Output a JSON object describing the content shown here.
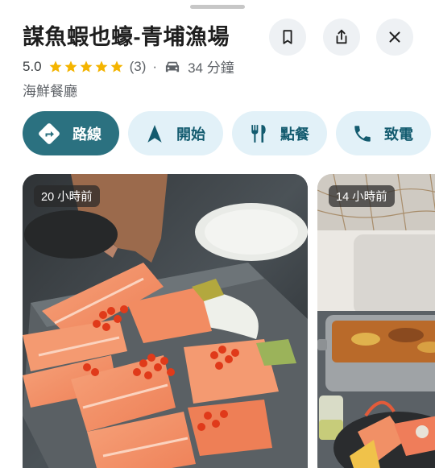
{
  "place": {
    "name": "謀魚蝦也蠔-青埔漁場",
    "rating": "5.0",
    "review_count": "(3)",
    "separator": "·",
    "drive_time": "34 分鐘",
    "category": "海鮮餐廳",
    "stars_filled": 5
  },
  "actions": {
    "directions": "路線",
    "start": "開始",
    "order": "點餐",
    "call": "致電"
  },
  "photos": [
    {
      "time_badge": "20 小時前"
    },
    {
      "time_badge": "14 小時前"
    }
  ],
  "colors": {
    "primary_chip": "#2b7180",
    "chip_bg": "#e2f1f8",
    "chip_text": "#135b6f",
    "star": "#f4b400"
  }
}
